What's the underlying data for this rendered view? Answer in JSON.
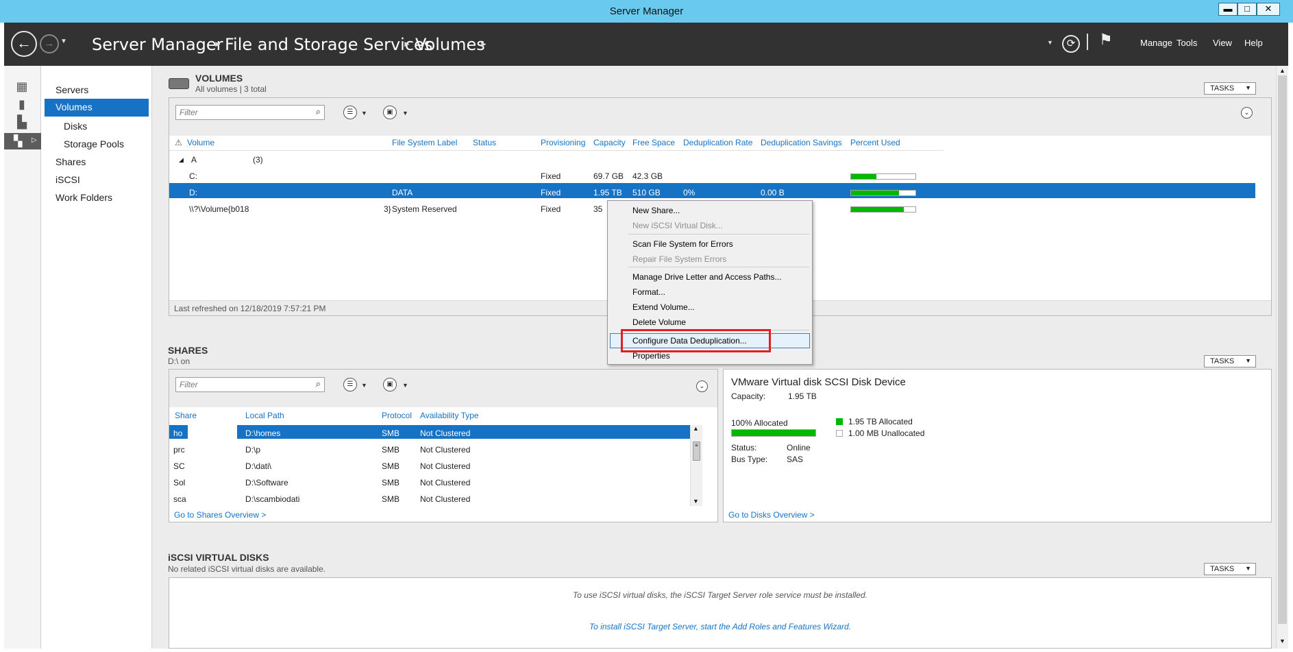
{
  "window": {
    "title": "Server Manager",
    "minimize": "▬",
    "maximize": "□",
    "close": "✕"
  },
  "header": {
    "breadcrumb": [
      "Server Manager",
      "File and Storage Services",
      "Volumes"
    ],
    "menus": [
      "Manage",
      "Tools",
      "View",
      "Help"
    ]
  },
  "nav": {
    "items": [
      "Servers",
      "Volumes",
      "Disks",
      "Storage Pools",
      "Shares",
      "iSCSI",
      "Work Folders"
    ],
    "selected": "Volumes"
  },
  "volumes": {
    "title": "VOLUMES",
    "subtitle": "All volumes | 3 total",
    "tasks": "TASKS",
    "filter_placeholder": "Filter",
    "columns": [
      "Volume",
      "File System Label",
      "Status",
      "Provisioning",
      "Capacity",
      "Free Space",
      "Deduplication Rate",
      "Deduplication Savings",
      "Percent Used"
    ],
    "group_label": "A",
    "group_count": "(3)",
    "rows": [
      {
        "volume": "C:",
        "label": "",
        "status": "",
        "provisioning": "Fixed",
        "capacity": "69.7 GB",
        "free": "42.3 GB",
        "dedup_rate": "",
        "dedup_savings": "",
        "percent_used": 0.39
      },
      {
        "volume": "D:",
        "label": "DATA",
        "status": "",
        "provisioning": "Fixed",
        "capacity": "1.95 TB",
        "free": "510 GB",
        "dedup_rate": "0%",
        "dedup_savings": "0.00 B",
        "percent_used": 0.74
      },
      {
        "volume": "\\\\?\\Volume{b018",
        "volume_tail": "3}",
        "label": "System Reserved",
        "status": "",
        "provisioning": "Fixed",
        "capacity": "35",
        "free": "",
        "dedup_rate": "",
        "dedup_savings": "",
        "percent_used": 0.82
      }
    ],
    "footer": "Last refreshed on 12/18/2019 7:57:21 PM"
  },
  "context_menu": {
    "items": [
      {
        "label": "New Share...",
        "enabled": true
      },
      {
        "label": "New iSCSI Virtual Disk...",
        "enabled": false
      },
      {
        "label": "Scan File System for Errors",
        "enabled": true
      },
      {
        "label": "Repair File System Errors",
        "enabled": false
      },
      {
        "label": "Manage Drive Letter and Access Paths...",
        "enabled": true
      },
      {
        "label": "Format...",
        "enabled": true
      },
      {
        "label": "Extend Volume...",
        "enabled": true
      },
      {
        "label": "Delete Volume",
        "enabled": true
      },
      {
        "label": "Configure Data Deduplication...",
        "enabled": true,
        "highlighted": true
      },
      {
        "label": "Properties",
        "enabled": true
      }
    ]
  },
  "shares": {
    "title": "SHARES",
    "subtitle": "D:\\ on",
    "tasks": "TASKS",
    "filter_placeholder": "Filter",
    "columns": [
      "Share",
      "Local Path",
      "Protocol",
      "Availability Type"
    ],
    "rows": [
      {
        "share": "ho",
        "path": "D:\\homes",
        "protocol": "SMB",
        "availability": "Not Clustered"
      },
      {
        "share": "prc",
        "path": "D:\\p",
        "protocol": "SMB",
        "availability": "Not Clustered"
      },
      {
        "share": "SC",
        "path": "D:\\dati\\",
        "protocol": "SMB",
        "availability": "Not Clustered"
      },
      {
        "share": "Sol",
        "path": "D:\\Software",
        "protocol": "SMB",
        "availability": "Not Clustered"
      },
      {
        "share": "sca",
        "path": "D:\\scambiodati",
        "protocol": "SMB",
        "availability": "Not Clustered"
      }
    ],
    "link": "Go to Shares Overview >"
  },
  "disk": {
    "name": "VMware Virtual disk SCSI Disk Device",
    "capacity_label": "Capacity:",
    "capacity": "1.95 TB",
    "allocated_pct_label": "100% Allocated",
    "allocated_fraction": 1.0,
    "legend_allocated": "1.95 TB Allocated",
    "legend_unallocated": "1.00 MB Unallocated",
    "status_label": "Status:",
    "status": "Online",
    "bustype_label": "Bus Type:",
    "bustype": "SAS",
    "link": "Go to Disks Overview >",
    "tasks": "TASKS"
  },
  "iscsi": {
    "title": "iSCSI VIRTUAL DISKS",
    "subtitle": "No related iSCSI virtual disks are available.",
    "tasks": "TASKS",
    "message": "To use iSCSI virtual disks, the iSCSI Target Server role service must be installed.",
    "link": "To install iSCSI Target Server, start the Add Roles and Features Wizard."
  },
  "colors": {
    "accent": "#1672c4",
    "header": "#323232",
    "titlebar": "#6ac9ef",
    "highlight": "#e51c23",
    "bar": "#00b800"
  }
}
